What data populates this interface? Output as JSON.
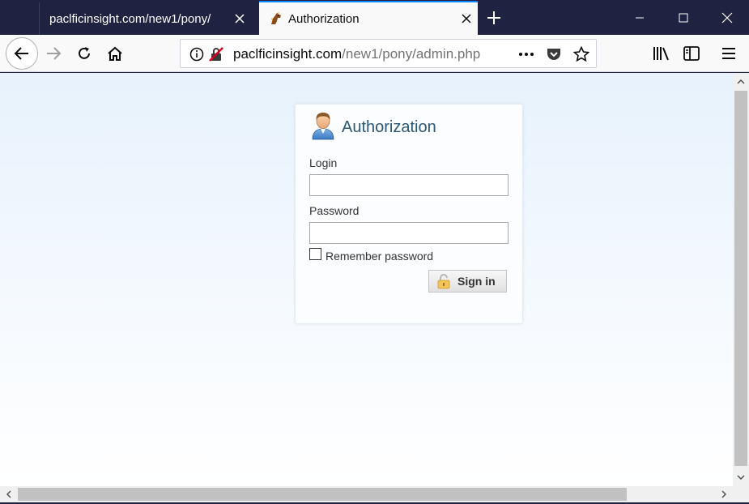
{
  "tabs": [
    {
      "title": "paclficinsight.com/new1/pony/",
      "active": false
    },
    {
      "title": "Authorization",
      "active": true
    }
  ],
  "icons": {
    "tab_close": "close-icon",
    "new_tab": "plus-icon",
    "minimize": "minimize-icon",
    "maximize": "maximize-icon",
    "close_window": "close-icon",
    "back": "back-arrow-icon",
    "forward": "forward-arrow-icon",
    "reload": "reload-icon",
    "home": "home-icon",
    "site_info": "info-icon",
    "insecure": "insecure-lock-icon",
    "page_actions": "ellipsis-icon",
    "pocket": "pocket-icon",
    "bookmark": "star-icon",
    "library": "library-icon",
    "sidebar": "sidebar-icon",
    "menu": "hamburger-icon"
  },
  "url": {
    "host": "paclficinsight.com",
    "path": "/new1/pony/admin.php"
  },
  "login": {
    "title": "Authorization",
    "login_label": "Login",
    "login_value": "",
    "password_label": "Password",
    "password_value": "",
    "remember_label": "Remember password",
    "remember_checked": false,
    "signin_label": "Sign in"
  },
  "colors": {
    "tabbar_bg": "#1f2241",
    "accent": "#0a84ff",
    "title_color": "#2c5777"
  }
}
